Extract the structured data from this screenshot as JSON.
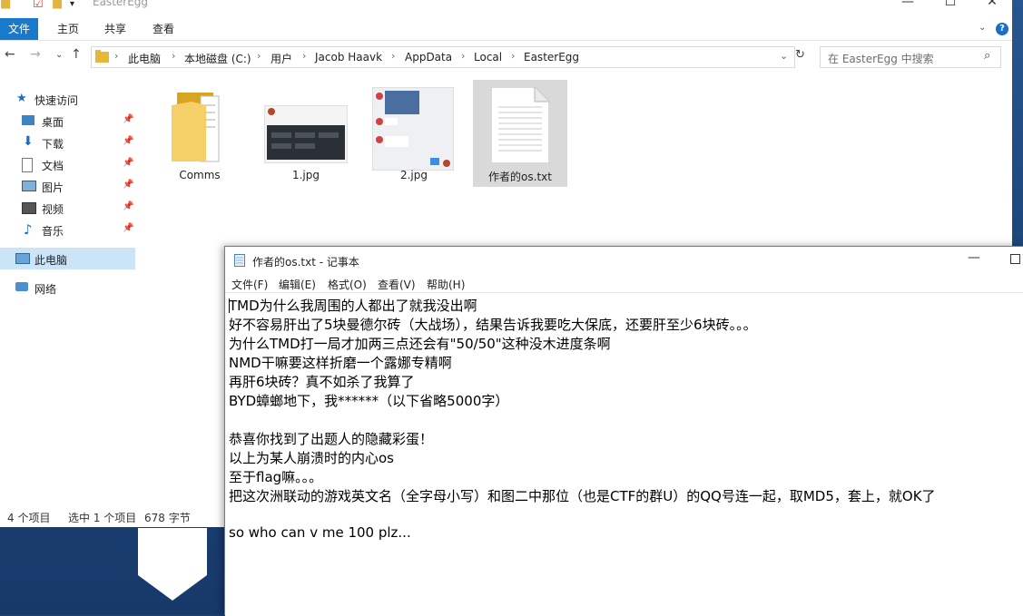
{
  "explorer": {
    "title": "EasterEgg",
    "ribbon_tabs": [
      "文件",
      "主页",
      "共享",
      "查看"
    ],
    "help_label": "?",
    "address": {
      "crumbs": [
        "此电脑",
        "本地磁盘 (C:)",
        "用户",
        "Jacob Haavk",
        "AppData",
        "Local",
        "EasterEgg"
      ]
    },
    "search": {
      "placeholder": "在 EasterEgg 中搜索"
    },
    "nav_pane": {
      "quick_access": "快速访问",
      "items": [
        {
          "label": "桌面",
          "icon": "desktop-icon"
        },
        {
          "label": "下载",
          "icon": "download-icon"
        },
        {
          "label": "文档",
          "icon": "document-icon"
        },
        {
          "label": "图片",
          "icon": "pictures-icon"
        },
        {
          "label": "视频",
          "icon": "video-icon"
        },
        {
          "label": "音乐",
          "icon": "music-icon"
        }
      ],
      "this_pc": "此电脑",
      "network": "网络"
    },
    "files": [
      {
        "name": "Comms",
        "type": "folder"
      },
      {
        "name": "1.jpg",
        "type": "image"
      },
      {
        "name": "2.jpg",
        "type": "image"
      },
      {
        "name": "作者的os.txt",
        "type": "text",
        "selected": true
      }
    ],
    "status": {
      "count": "4 个项目",
      "selection": "选中 1 个项目",
      "size": "678 字节"
    }
  },
  "notepad": {
    "title": "作者的os.txt - 记事本",
    "menu": [
      "文件(F)",
      "编辑(E)",
      "格式(O)",
      "查看(V)",
      "帮助(H)"
    ],
    "lines": [
      "TMD为什么我周围的人都出了就我没出啊",
      "好不容易肝出了5块曼德尔砖（大战场），结果告诉我要吃大保底，还要肝至少6块砖。。。",
      "为什么TMD打一局才加两三点还会有\"50/50\"这种没木进度条啊",
      "NMD干嘛要这样折磨一个露娜专精啊",
      "再肝6块砖？真不如杀了我算了",
      "BYD蟑螂地下，我******（以下省略5000字）",
      "",
      "恭喜你找到了出题人的隐藏彩蛋！",
      "以上为某人崩溃时的内心os",
      "至于flag嘛。。。",
      "把这次洲联动的游戏英文名（全字母小写）和图二中那位（也是CTF的群U）的QQ号连一起，取MD5，套上，就OK了",
      "",
      "so who can v me 100 plz..."
    ]
  },
  "colors": {
    "accent": "#1979ca",
    "selection": "#cce4f7",
    "selected_file": "#d9d9d9",
    "desktop": "#1c4578"
  }
}
